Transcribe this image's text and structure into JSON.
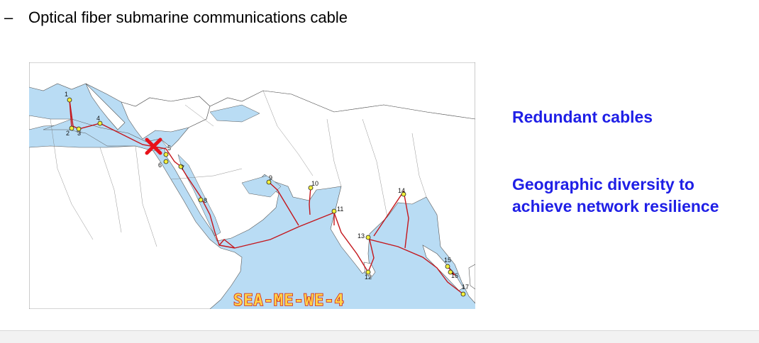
{
  "slide": {
    "bullet_symbol": "–",
    "bullet_text": "Optical fiber submarine communications cable"
  },
  "map": {
    "banner_text": "SEA-ME-WE-4",
    "station_labels": [
      "1",
      "2",
      "3",
      "4",
      "5",
      "6",
      "7",
      "8",
      "9",
      "10",
      "11",
      "12",
      "13",
      "14",
      "15",
      "16",
      "17"
    ],
    "colors": {
      "sea": "#b9dcf4",
      "land": "#ffffff",
      "cable": "#c4161c",
      "break_marker": "#e8121a",
      "station": "#f3ee3b"
    }
  },
  "side_notes": {
    "note1": "Redundant cables",
    "note2": "Geographic diversity to achieve network resilience"
  }
}
